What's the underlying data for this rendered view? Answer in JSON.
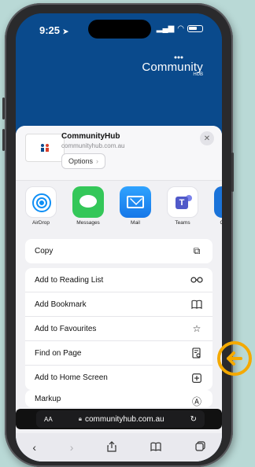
{
  "status": {
    "time": "9:25",
    "arrow_icon": "location-arrow-icon"
  },
  "website": {
    "brand_name": "Community",
    "brand_sub": "HUB"
  },
  "share_sheet": {
    "title": "CommunityHub",
    "url": "communityhub.com.au",
    "options_label": "Options",
    "close_icon": "close-icon",
    "apps": [
      {
        "label": "AirDrop",
        "icon": "airdrop-icon"
      },
      {
        "label": "Messages",
        "icon": "messages-icon"
      },
      {
        "label": "Mail",
        "icon": "mail-icon"
      },
      {
        "label": "Teams",
        "icon": "teams-icon"
      },
      {
        "label": "O",
        "icon": "outlook-icon"
      }
    ],
    "actions_group1": [
      {
        "label": "Copy",
        "icon": "copy-icon"
      }
    ],
    "actions_group2": [
      {
        "label": "Add to Reading List",
        "icon": "glasses-icon"
      },
      {
        "label": "Add Bookmark",
        "icon": "book-icon"
      },
      {
        "label": "Add to Favourites",
        "icon": "star-icon"
      },
      {
        "label": "Find on Page",
        "icon": "find-on-page-icon"
      },
      {
        "label": "Add to Home Screen",
        "icon": "add-square-icon"
      }
    ],
    "actions_group3": [
      {
        "label": "Markup",
        "icon": "markup-icon"
      }
    ]
  },
  "address_bar": {
    "aa": "AA",
    "url": "communityhub.com.au"
  },
  "colors": {
    "brand_blue": "#0a4a8c",
    "callout": "#f4a900",
    "background": "#b9d9d6"
  }
}
